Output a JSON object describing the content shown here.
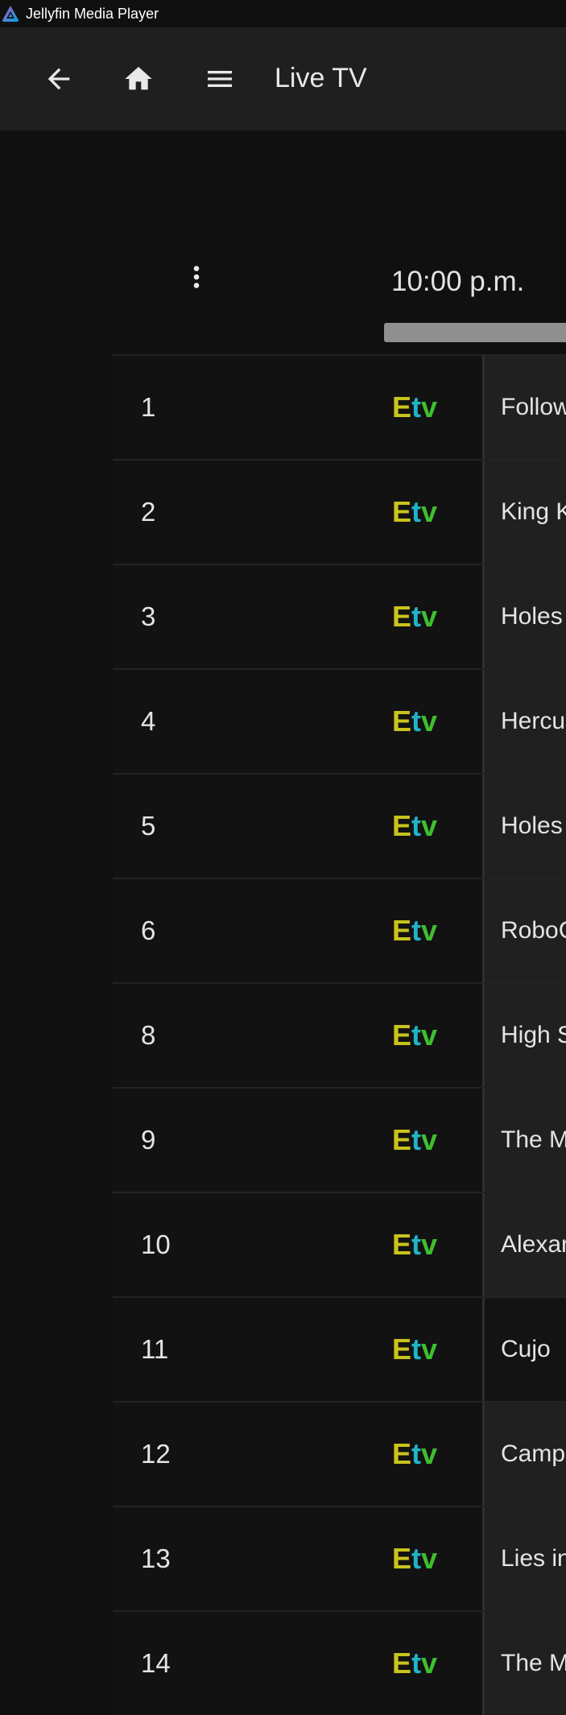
{
  "window": {
    "title": "Jellyfin Media Player"
  },
  "header": {
    "page_title": "Live TV"
  },
  "guide": {
    "timeslot": "10:00 p.m.",
    "channels": [
      {
        "number": "1",
        "logo": [
          "E",
          "t",
          "v"
        ],
        "program": "Follow"
      },
      {
        "number": "2",
        "logo": [
          "E",
          "t",
          "v"
        ],
        "program": "King K"
      },
      {
        "number": "3",
        "logo": [
          "E",
          "t",
          "v"
        ],
        "program": "Holes"
      },
      {
        "number": "4",
        "logo": [
          "E",
          "t",
          "v"
        ],
        "program": "Hercu"
      },
      {
        "number": "5",
        "logo": [
          "E",
          "t",
          "v"
        ],
        "program": "Holes"
      },
      {
        "number": "6",
        "logo": [
          "E",
          "t",
          "v"
        ],
        "program": "RoboC"
      },
      {
        "number": "8",
        "logo": [
          "E",
          "t",
          "v"
        ],
        "program": "High S"
      },
      {
        "number": "9",
        "logo": [
          "E",
          "t",
          "v"
        ],
        "program": "The M"
      },
      {
        "number": "10",
        "logo": [
          "E",
          "t",
          "v"
        ],
        "program": "Alexar"
      },
      {
        "number": "11",
        "logo": [
          "E",
          "t",
          "v"
        ],
        "program": "Cujo"
      },
      {
        "number": "12",
        "logo": [
          "E",
          "t",
          "v"
        ],
        "program": "Camp"
      },
      {
        "number": "13",
        "logo": [
          "E",
          "t",
          "v"
        ],
        "program": "Lies in"
      },
      {
        "number": "14",
        "logo": [
          "E",
          "t",
          "v"
        ],
        "program": "The M"
      }
    ]
  },
  "icons": {
    "app": "jellyfin-logo-icon",
    "back": "back-arrow-icon",
    "home": "home-icon",
    "menu": "hamburger-menu-icon",
    "more": "more-vertical-icon"
  },
  "colors": {
    "header_bg": "#1f1f1f",
    "page_bg": "#101010",
    "logo_e": "#c9c31c",
    "logo_t": "#22b3c7",
    "logo_v": "#3fbf2f"
  }
}
